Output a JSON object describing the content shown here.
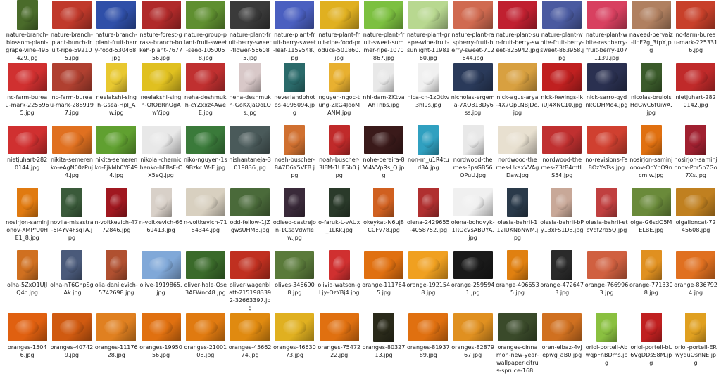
{
  "files": [
    {
      "name": "nature-branch-blossom-plant-grape-vine-495429.jpg",
      "color": "#4a6b2a",
      "shape": "portrait"
    },
    {
      "name": "nature-branch-plant-bunch-fruit-ripe-592105.jpg",
      "color": "#c0392b",
      "shape": "land"
    },
    {
      "name": "nature-branch-plant-fruit-berry-food-530468.jpg",
      "color": "#2f4fa8",
      "shape": "land"
    },
    {
      "name": "nature-forest-grass-branch-bokeh-plant-767756.jpg",
      "color": "#b02a2a",
      "shape": "land"
    },
    {
      "name": "nature-group-plant-fruit-sweet-seed-1050058.jpg",
      "color": "#5f8f30",
      "shape": "land"
    },
    {
      "name": "nature-plant-fruit-berry-sweet-flower-566085.jpg",
      "color": "#3a3a3a",
      "shape": "land"
    },
    {
      "name": "nature-plant-fruit-berry-sweet-leaf-1159548.jpg",
      "color": "#4a5fc0",
      "shape": "land"
    },
    {
      "name": "nature-plant-fruit-ripe-food-produce-501860.jpg",
      "color": "#e0b020",
      "shape": "land"
    },
    {
      "name": "nature-plant-fruit-sweet-summer-ripe-1070867.jpg",
      "color": "#7cc040",
      "shape": "land"
    },
    {
      "name": "nature-plant-grape-wine-fruit-sunlight-1198160.jpg",
      "color": "#b8d890",
      "shape": "land"
    },
    {
      "name": "nature-plant-raspberry-fruit-berry-sweet-712644.jpg",
      "color": "#d06a50",
      "shape": "land"
    },
    {
      "name": "nature-plant-sun-fruit-berry-sweet-825942.jpg",
      "color": "#c02030",
      "shape": "land"
    },
    {
      "name": "nature-plant-white-fruit-berry-sweet-863958.jpg",
      "color": "#4a5aa0",
      "shape": "land"
    },
    {
      "name": "nature-plant-white-raspberry-fruit-berry-1071139.jpg",
      "color": "#d84060",
      "shape": "land"
    },
    {
      "name": "naveed-pervaiz-llnF2g_3tpY.jpg",
      "color": "#b08060",
      "shape": "land"
    },
    {
      "name": "nc-farm-bureau-mark-2253316.jpg",
      "color": "#c8402a",
      "shape": "land"
    },
    {
      "name": "nc-farm-bureau-mark-2255965.jpg",
      "color": "#d03030",
      "shape": "land"
    },
    {
      "name": "nc-farm-bureau-mark-2889197.jpg",
      "color": "#b04030",
      "shape": "land"
    },
    {
      "name": "neelakshi-singh-Gsea-HpI_Aw.jpg",
      "color": "#e8c830",
      "shape": "portrait"
    },
    {
      "name": "neelakshi-singh-QfQbRnOgAwY.jpg",
      "color": "#e0c020",
      "shape": "land"
    },
    {
      "name": "neha-deshmukh-cYZxxz4AweE.jpg",
      "color": "#c03030",
      "shape": "land"
    },
    {
      "name": "neha-deshmukh-GoKXJaQoLQs.jpg",
      "color": "#d8c8c8",
      "shape": "portrait"
    },
    {
      "name": "neverlandphotos-4995094.jpg",
      "color": "#2a6a6a",
      "shape": "portrait"
    },
    {
      "name": "nguyen-ngoc-tung-ZkG4JdoMANM.jpg",
      "color": "#e8b030",
      "shape": "portrait"
    },
    {
      "name": "nhi-dam-ZKtvaAhTnbs.jpg",
      "color": "#e8e8e8",
      "shape": "portrait"
    },
    {
      "name": "nica-cn-1zOtkv3hI9s.jpg",
      "color": "#f0f0f0",
      "shape": "portrait"
    },
    {
      "name": "nicholas-ergemla-7XQ813Dy6ss.jpg",
      "color": "#2a3a5a",
      "shape": "land"
    },
    {
      "name": "nick-agus-arya-4X7QpLNBjDc.jpg",
      "color": "#d8a040",
      "shape": "land"
    },
    {
      "name": "nick-fewings-IkiUJ4XNC10.jpg",
      "color": "#c02020",
      "shape": "land"
    },
    {
      "name": "nick-sarro-qydnkODHMo4.jpg",
      "color": "#2a3050",
      "shape": "land"
    },
    {
      "name": "nicolas-bruloisHdGwC6fUiwA.jpg",
      "color": "#3a5a2a",
      "shape": "portrait"
    },
    {
      "name": "nietjuhart-2820142.jpg",
      "color": "#c02a2a",
      "shape": "land"
    },
    {
      "name": "nietjuhart-2820144.jpg",
      "color": "#d03030",
      "shape": "land"
    },
    {
      "name": "nikita-semerenko-eAgN00zPuj4.jpg",
      "color": "#e07020",
      "shape": "land"
    },
    {
      "name": "nikita-semerenko-FjkMb0Y849 4.jpg",
      "color": "#60a030",
      "shape": "land"
    },
    {
      "name": "nikolai-chernichenko-hFBsF-CX5eQ.jpg",
      "color": "#e8e8e8",
      "shape": "land"
    },
    {
      "name": "niko-nguyen-1s9BzkcIW-E.jpg",
      "color": "#3a7a3a",
      "shape": "land"
    },
    {
      "name": "nishantaneja-3019836.jpg",
      "color": "#4a5a5a",
      "shape": "land"
    },
    {
      "name": "noah-buscher-8A7D6Y5VFB.jpg",
      "color": "#d07030",
      "shape": "portrait"
    },
    {
      "name": "noah-buscher-3IFM-1UF5b0.jpg",
      "color": "#c02a2a",
      "shape": "portrait"
    },
    {
      "name": "nohe-pereira-8Vi4VVpRs_Q.jpg",
      "color": "#3a1a1a",
      "shape": "land"
    },
    {
      "name": "non-m_u1R4tud3A.jpg",
      "color": "#30a0c0",
      "shape": "portrait"
    },
    {
      "name": "nordwood-themes-3psGB56OPuU.jpg",
      "color": "#e8e8e8",
      "shape": "portrait"
    },
    {
      "name": "nordwood-themes-UkaxVVAgDaw.jpg",
      "color": "#e8e0d0",
      "shape": "land"
    },
    {
      "name": "nordwood-themes-Z3tB4mtLS54.jpg",
      "color": "#c03030",
      "shape": "land"
    },
    {
      "name": "no-revisions-Fa8OzYsTss.jpg",
      "color": "#d04030",
      "shape": "land"
    },
    {
      "name": "nosirjon-saminjonov-OoYnO9ncmIw.jpg",
      "color": "#e07010",
      "shape": "portrait"
    },
    {
      "name": "nosirjon-saminjonov-Pcr5b7Go7Xs.jpg",
      "color": "#a02030",
      "shape": "portrait"
    },
    {
      "name": "nosirjon-saminjonov-XMPfU0HE1_8.jpg",
      "color": "#e07a10",
      "shape": "portrait"
    },
    {
      "name": "novila-misastra-5I4Yv4FsqTA.jpg",
      "color": "#3a5a3a",
      "shape": "portrait"
    },
    {
      "name": "n-voitkevich-4772846.jpg",
      "color": "#a01820",
      "shape": "portrait"
    },
    {
      "name": "n-voitkevich-6669413.jpg",
      "color": "#d8d0c8",
      "shape": "portrait"
    },
    {
      "name": "n-voitkevich-7184344.jpg",
      "color": "#d8d0c0",
      "shape": "land"
    },
    {
      "name": "odd-fellow-1JZgwsUHM8.jpg",
      "color": "#4a6a3a",
      "shape": "land"
    },
    {
      "name": "odiseo-castrejon-1CsaVdwflew.jpg",
      "color": "#3a2a3a",
      "shape": "portrait"
    },
    {
      "name": "o-faruk-L-vAUx_1LKk.jpg",
      "color": "#2a3a2a",
      "shape": "portrait"
    },
    {
      "name": "okeykat-N6uj8CCFv78.jpg",
      "color": "#d06020",
      "shape": "portrait"
    },
    {
      "name": "olena-2429655-4058752.jpg",
      "color": "#b03030",
      "shape": "portrait"
    },
    {
      "name": "olena-bohovyk-1ROcVsABUYA.jpg",
      "color": "#f0f0f0",
      "shape": "land"
    },
    {
      "name": "olesia-bahrii-112lUKNbNwM.jpg",
      "color": "#2a3a4a",
      "shape": "portrait"
    },
    {
      "name": "olesia-bahrii-bPy13xFS1D8.jpg",
      "color": "#c8a898",
      "shape": "portrait"
    },
    {
      "name": "olesia-bahrii-etcVdf2rb5Q.jpg",
      "color": "#c04040",
      "shape": "portrait"
    },
    {
      "name": "olga-G6sdO5MELBE.jpg",
      "color": "#6a8a3a",
      "shape": "land"
    },
    {
      "name": "olgalioncat-7245608.jpg",
      "color": "#c08020",
      "shape": "land"
    },
    {
      "name": "olha-5ZxO1UJJQ4c.jpg",
      "color": "#d07020",
      "shape": "portrait"
    },
    {
      "name": "olha-nT6GhpSglAk.jpg",
      "color": "#4a5a7a",
      "shape": "portrait"
    },
    {
      "name": "olia-danilevich-5742698.jpg",
      "color": "#b05030",
      "shape": "portrait"
    },
    {
      "name": "olive-1919865.jpg",
      "color": "#80a8d8",
      "shape": "land"
    },
    {
      "name": "oliver-hale-Qse3AFWnc48.jpg",
      "color": "#3a6a2a",
      "shape": "land"
    },
    {
      "name": "oliver-wagenblatt-2151983392-32663397.jpg",
      "color": "#c03020",
      "shape": "land"
    },
    {
      "name": "olives-3466908.jpg",
      "color": "#5a7a3a",
      "shape": "land"
    },
    {
      "name": "olivia-watson-gLjy-OzYBj4.jpg",
      "color": "#d03030",
      "shape": "portrait"
    },
    {
      "name": "orange-1117645.jpg",
      "color": "#e07010",
      "shape": "land"
    },
    {
      "name": "orange-1921548.jpg",
      "color": "#f0a020",
      "shape": "land"
    },
    {
      "name": "orange-2595941.jpg",
      "color": "#1a1a1a",
      "shape": "land"
    },
    {
      "name": "orange-4066535.jpg",
      "color": "#e08010",
      "shape": "portrait"
    },
    {
      "name": "orange-4726473.jpg",
      "color": "#2a2a2a",
      "shape": "portrait"
    },
    {
      "name": "orange-7669963.jpg",
      "color": "#d06040",
      "shape": "land"
    },
    {
      "name": "orange-7713308.jpg",
      "color": "#e09020",
      "shape": "portrait"
    },
    {
      "name": "orange-8367924.jpg",
      "color": "#e07020",
      "shape": "land"
    },
    {
      "name": "oranges-15046.jpg",
      "color": "#e06010",
      "shape": "land"
    },
    {
      "name": "oranges-407429.jpg",
      "color": "#d05a10",
      "shape": "land"
    },
    {
      "name": "oranges-1117628.jpg",
      "color": "#e08020",
      "shape": "land"
    },
    {
      "name": "oranges-1995056.jpg",
      "color": "#e07010",
      "shape": "land"
    },
    {
      "name": "oranges-2100108.jpg",
      "color": "#e07a10",
      "shape": "land"
    },
    {
      "name": "oranges-4566274.jpg",
      "color": "#e08a10",
      "shape": "land"
    },
    {
      "name": "oranges-4663073.jpg",
      "color": "#e0b020",
      "shape": "land"
    },
    {
      "name": "oranges-7547222.jpg",
      "color": "#e07010",
      "shape": "land"
    },
    {
      "name": "oranges-8032713.jpg",
      "color": "#2a2a1a",
      "shape": "portrait"
    },
    {
      "name": "oranges-8193789.jpg",
      "color": "#e07010",
      "shape": "land"
    },
    {
      "name": "oranges-8287967.jpg",
      "color": "#e09020",
      "shape": "land"
    },
    {
      "name": "oranges-cinnamon-new-year-wallpaper-citrus-spruce-168...",
      "color": "#3a4a2a",
      "shape": "land"
    },
    {
      "name": "oren-elbaz-4vJepwg_aB0.jpg",
      "color": "#d07020",
      "shape": "land"
    },
    {
      "name": "oriol-portell-AbwqpFnBDms.jpg",
      "color": "#8ac040",
      "shape": "portrait"
    },
    {
      "name": "oriol-portell-bL6VgDDsS8M.jpg",
      "color": "#c02020",
      "shape": "portrait"
    },
    {
      "name": "oriol-portell-ERwyquOsnNE.jpg",
      "color": "#e0a020",
      "shape": "portrait"
    }
  ]
}
